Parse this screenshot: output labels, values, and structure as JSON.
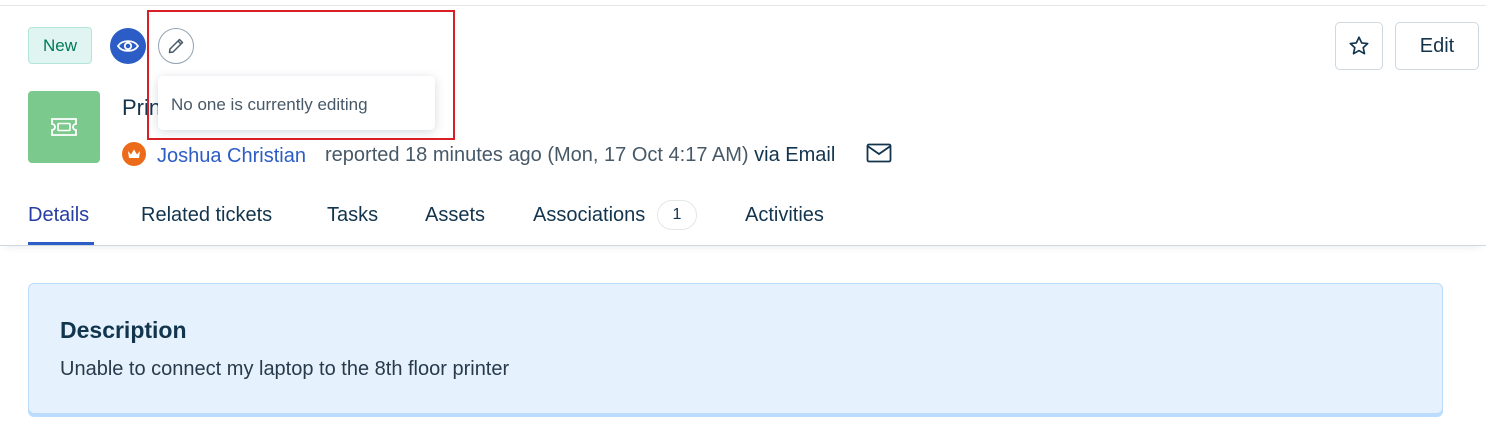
{
  "ticket": {
    "status": "New",
    "subject": "Printer not connecting",
    "requester": "Joshua Christian",
    "reported": "reported 18 minutes ago (Mon, 17 Oct 4:17 AM)",
    "via": "via Email"
  },
  "tooltip": {
    "text": "No one is currently editing"
  },
  "actions": {
    "edit_label": "Edit"
  },
  "tabs": [
    {
      "label": "Details"
    },
    {
      "label": "Related tickets"
    },
    {
      "label": "Tasks"
    },
    {
      "label": "Assets"
    },
    {
      "label": "Associations",
      "count": "1"
    },
    {
      "label": "Activities"
    }
  ],
  "description": {
    "title": "Description",
    "body": "Unable to connect my laptop to the 8th floor printer"
  },
  "icons": {
    "watch": "eye-icon",
    "editing": "pencil-icon",
    "favorite": "star-icon",
    "ticket": "ticket-icon",
    "requester": "crown-icon",
    "source": "email-icon"
  },
  "colors": {
    "accent": "#2c5cc5",
    "status_bg": "#e0f5f1",
    "ticket_icon_bg": "#7bc98c",
    "card_bg": "#e5f2fd",
    "highlight": "#d81f26"
  }
}
